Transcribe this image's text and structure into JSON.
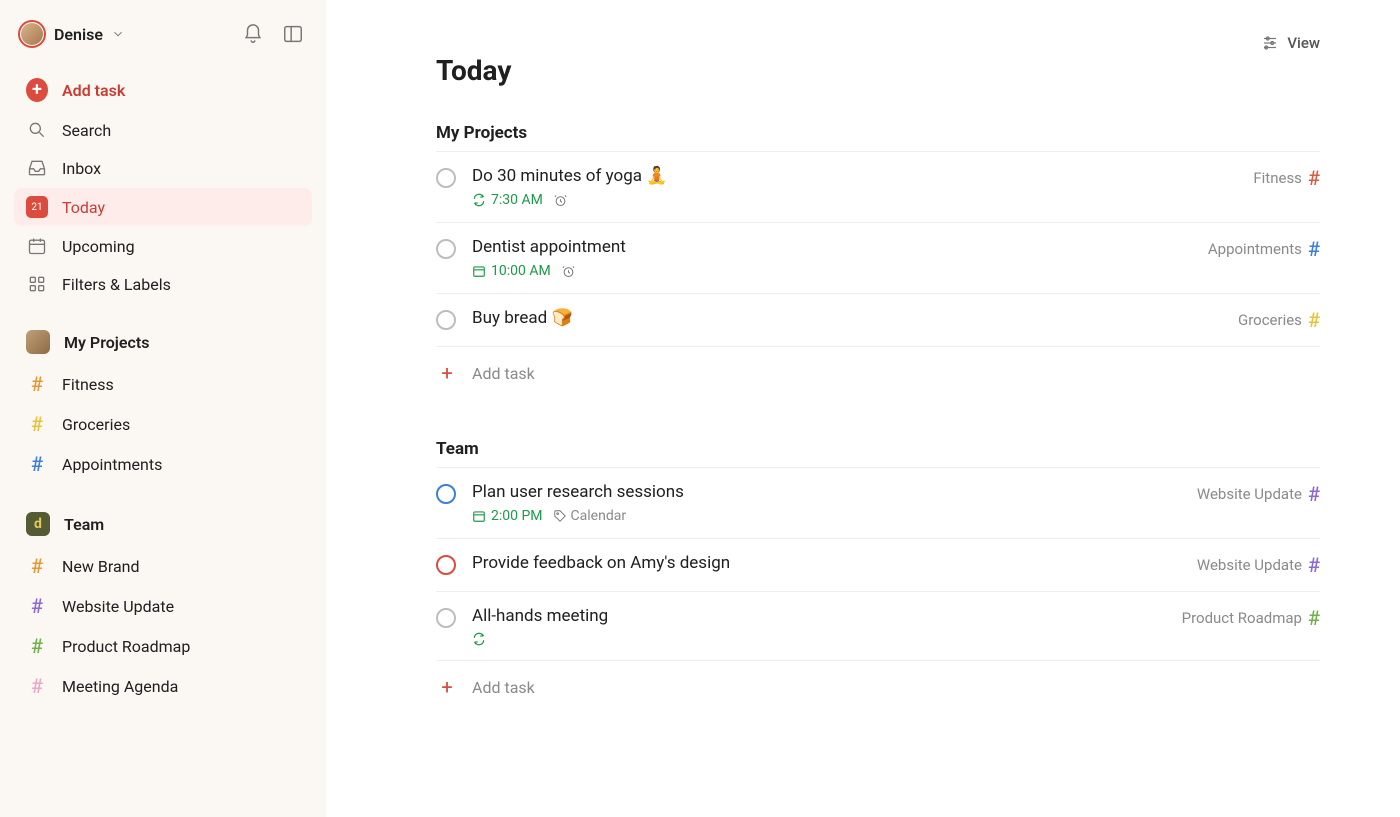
{
  "user": {
    "name": "Denise"
  },
  "sidebar": {
    "add_task": "Add task",
    "nav": {
      "search": "Search",
      "inbox": "Inbox",
      "today": "Today",
      "upcoming": "Upcoming",
      "filters": "Filters & Labels",
      "today_date": "21"
    },
    "my_projects_header": "My Projects",
    "my_projects": [
      {
        "label": "Fitness",
        "color": "hash-orange"
      },
      {
        "label": "Groceries",
        "color": "hash-yellow"
      },
      {
        "label": "Appointments",
        "color": "hash-blue"
      }
    ],
    "team_header": "Team",
    "team_badge": "d",
    "team_projects": [
      {
        "label": "New Brand",
        "color": "hash-orange"
      },
      {
        "label": "Website Update",
        "color": "hash-purple"
      },
      {
        "label": "Product Roadmap",
        "color": "hash-green"
      },
      {
        "label": "Meeting Agenda",
        "color": "hash-pink"
      }
    ]
  },
  "view_label": "View",
  "page_title": "Today",
  "sections": [
    {
      "title": "My Projects",
      "tasks": [
        {
          "title": "Do 30 minutes of yoga 🧘",
          "checkbox_color": "",
          "recurring": true,
          "time_icon": "none",
          "time": "7:30 AM",
          "has_alarm": true,
          "extra_label": "",
          "project": "Fitness",
          "project_color": "hash-red"
        },
        {
          "title": "Dentist appointment",
          "checkbox_color": "",
          "recurring": false,
          "time_icon": "calendar",
          "time": "10:00 AM",
          "has_alarm": true,
          "extra_label": "",
          "project": "Appointments",
          "project_color": "hash-blue"
        },
        {
          "title": "Buy bread 🍞",
          "checkbox_color": "",
          "recurring": false,
          "time_icon": "",
          "time": "",
          "has_alarm": false,
          "extra_label": "",
          "project": "Groceries",
          "project_color": "hash-yellow"
        }
      ],
      "add_task": "Add task"
    },
    {
      "title": "Team",
      "tasks": [
        {
          "title": "Plan user research sessions",
          "checkbox_color": "blue",
          "recurring": false,
          "time_icon": "calendar",
          "time": "2:00 PM",
          "has_alarm": false,
          "extra_label": "Calendar",
          "project": "Website Update",
          "project_color": "hash-purple"
        },
        {
          "title": "Provide feedback on Amy's design",
          "checkbox_color": "red",
          "recurring": false,
          "time_icon": "",
          "time": "",
          "has_alarm": false,
          "extra_label": "",
          "project": "Website Update",
          "project_color": "hash-purple"
        },
        {
          "title": "All-hands meeting",
          "checkbox_color": "",
          "recurring": true,
          "time_icon": "",
          "time": "",
          "has_alarm": false,
          "extra_label": "",
          "project": "Product Roadmap",
          "project_color": "hash-green"
        }
      ],
      "add_task": "Add task"
    }
  ]
}
